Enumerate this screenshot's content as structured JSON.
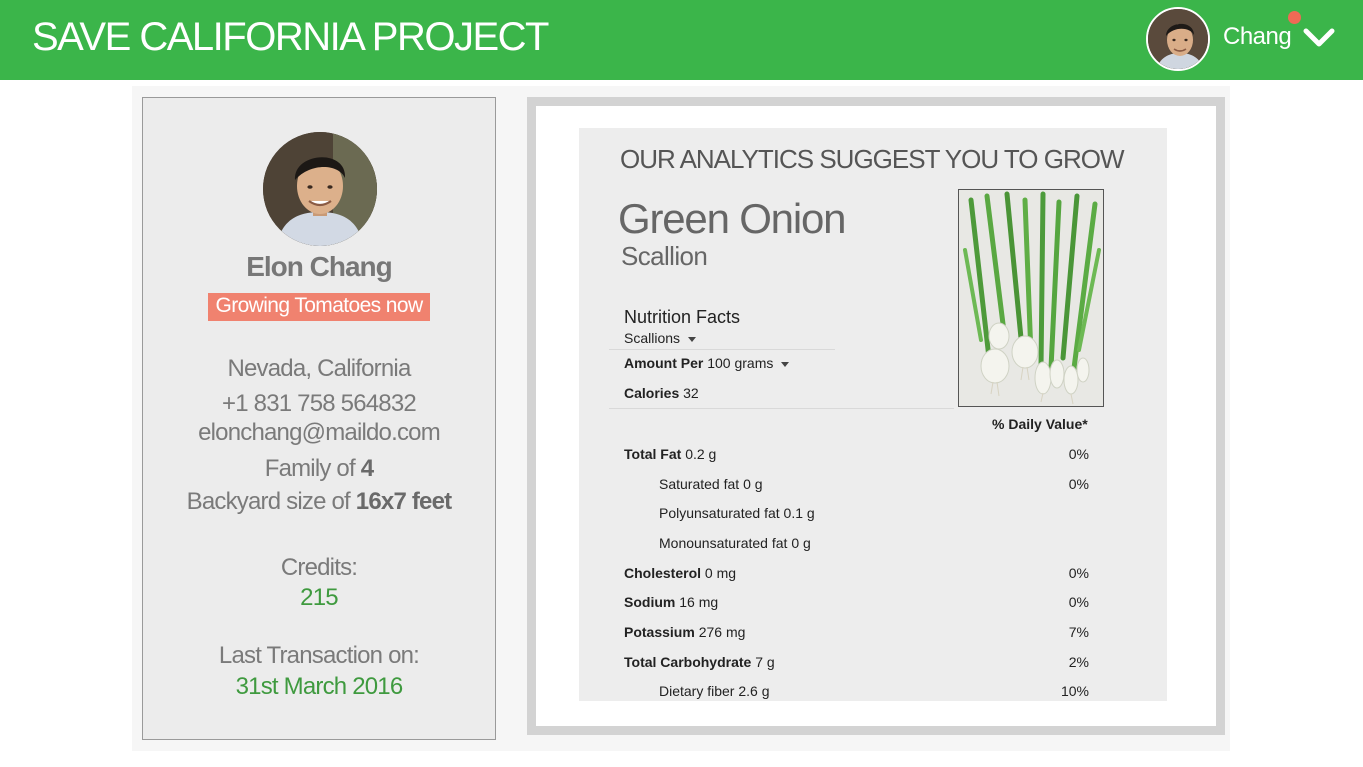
{
  "header": {
    "app_title": "SAVE CALIFORNIA PROJECT",
    "user_name": "Chang"
  },
  "profile": {
    "name": "Elon Chang",
    "status": "Growing Tomatoes now",
    "location": "Nevada, California",
    "phone": "+1 831 758 564832",
    "email": "elonchang@maildo.com",
    "family_prefix": "Family of",
    "family_value": "4",
    "backyard_prefix": "Backyard size of",
    "backyard_value": "16x7 feet",
    "credits_label": "Credits:",
    "credits_value": "215",
    "last_tx_label": "Last Transaction on:",
    "last_tx_value": "31st March 2016"
  },
  "recommendation": {
    "heading": "OUR ANALYTICS SUGGEST YOU TO GROW",
    "plant_name": "Green Onion",
    "plant_alt_name": "Scallion",
    "nutrition": {
      "title": "Nutrition Facts",
      "item_select": "Scallions",
      "amount_label": "Amount Per",
      "amount_unit": "100 grams",
      "calories_label": "Calories",
      "calories_value": "32",
      "daily_value_header": "% Daily Value*",
      "rows": [
        {
          "label": "Total Fat",
          "amount": "0.2 g",
          "pct": "0%",
          "bold": true
        },
        {
          "label": "Saturated fat",
          "amount": "0 g",
          "pct": "0%",
          "bold": false
        },
        {
          "label": "Polyunsaturated fat",
          "amount": "0.1 g",
          "pct": "",
          "bold": false
        },
        {
          "label": "Monounsaturated fat",
          "amount": "0 g",
          "pct": "",
          "bold": false
        },
        {
          "label": "Cholesterol",
          "amount": "0 mg",
          "pct": "0%",
          "bold": true
        },
        {
          "label": "Sodium",
          "amount": "16 mg",
          "pct": "0%",
          "bold": true
        },
        {
          "label": "Potassium",
          "amount": "276 mg",
          "pct": "7%",
          "bold": true
        },
        {
          "label": "Total Carbohydrate",
          "amount": "7 g",
          "pct": "2%",
          "bold": true
        },
        {
          "label": "Dietary fiber",
          "amount": "2.6 g",
          "pct": "10%",
          "bold": false
        }
      ]
    }
  },
  "colors": {
    "header_green": "#3bb54a",
    "status_salmon": "#f0826f",
    "accent_green": "#3f9a3f",
    "notification_dot": "#ef6a55"
  },
  "icons": {
    "menu_toggle": "chevron-down-icon",
    "notification": "notification-dot-icon"
  }
}
